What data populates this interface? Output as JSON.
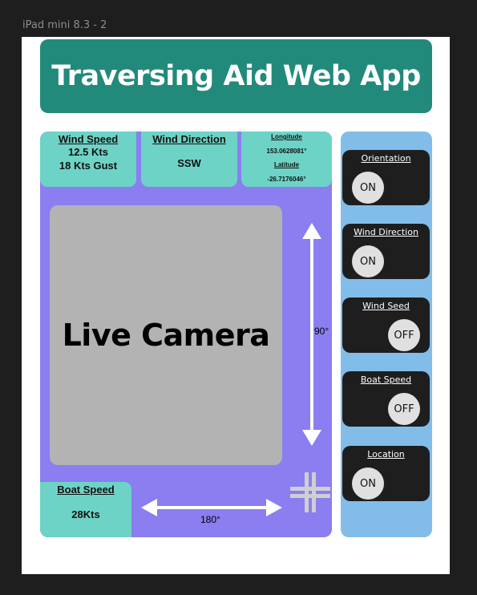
{
  "frame_label": "iPad mini 8.3 - 2",
  "header": {
    "title": "Traversing Aid Web App"
  },
  "info": {
    "wind_speed": {
      "title": "Wind Speed",
      "line1": "12.5 Kts",
      "line2": "18 Kts Gust"
    },
    "wind_direction": {
      "title": "Wind Direction",
      "value": "SSW"
    },
    "coordinates": {
      "longitude_title": "Longitude",
      "longitude_value": "153.0628081°",
      "latitude_title": "Latitude",
      "latitude_value": "-26.7176046°"
    },
    "boat_speed": {
      "title": "Boat Speed",
      "value": "28Kts"
    }
  },
  "camera": {
    "label": "Live Camera"
  },
  "angles": {
    "vertical": "90°",
    "horizontal": "180°"
  },
  "toggles": [
    {
      "label": "Orientation",
      "state": "ON"
    },
    {
      "label": "Wind Direction",
      "state": "ON"
    },
    {
      "label": "Wind Seed",
      "state": "OFF"
    },
    {
      "label": "Boat Speed",
      "state": "OFF"
    },
    {
      "label": "Location",
      "state": "ON"
    }
  ],
  "colors": {
    "header": "#218a7b",
    "main_panel": "#8a7ef0",
    "info_card": "#6dd3c6",
    "side_panel": "#82bde9",
    "toggle_bg": "#1e1e1e",
    "camera_bg": "#b3b3b3"
  },
  "icons": [
    "double-arrow-vertical-icon",
    "double-arrow-horizontal-icon",
    "move-cross-icon"
  ]
}
